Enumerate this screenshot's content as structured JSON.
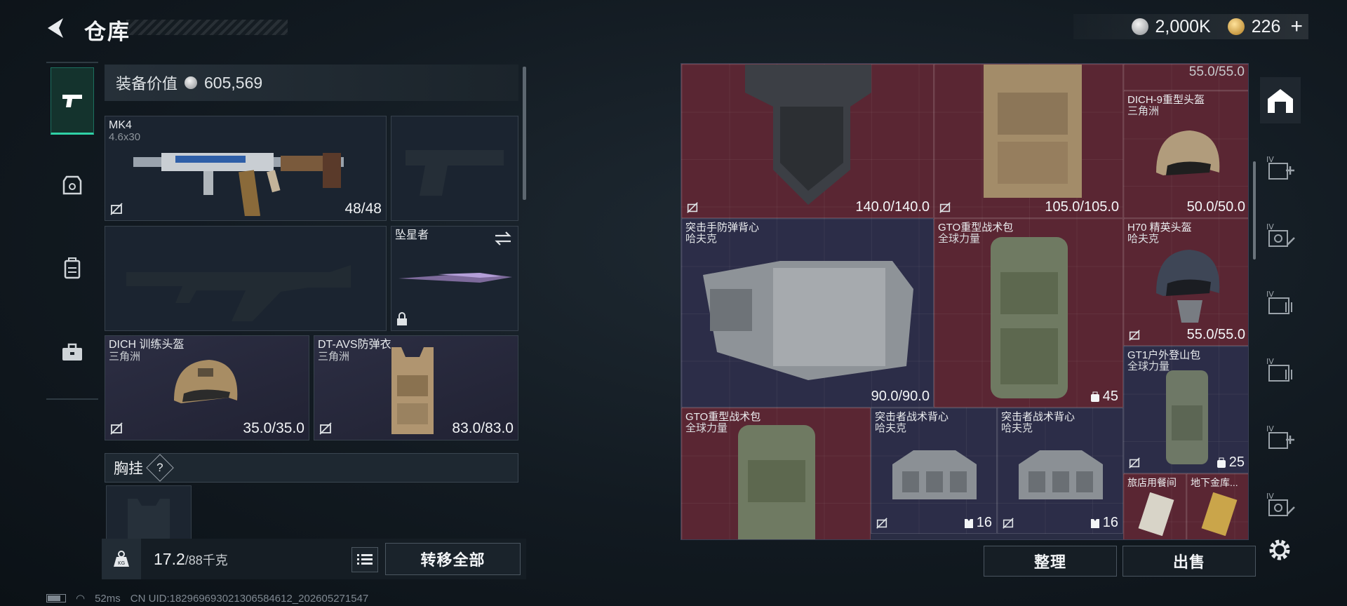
{
  "header": {
    "title": "仓库"
  },
  "currency": {
    "silver": "2,000K",
    "gold": "226",
    "plus": "+"
  },
  "equipment": {
    "value_label": "装备价值",
    "value": "605,569",
    "primary_weapon": {
      "name": "MK4",
      "caliber": "4.6x30",
      "durability": "48/48"
    },
    "melee": {
      "name": "坠星者"
    },
    "helmet": {
      "name": "DICH 训练头盔",
      "maker": "三角洲",
      "durability": "35.0/35.0"
    },
    "armor": {
      "name": "DT-AVS防弹衣",
      "maker": "三角洲",
      "durability": "83.0/83.0"
    },
    "chest_rig_label": "胸挂",
    "help": "?"
  },
  "footer": {
    "weight_current": "17.2",
    "weight_max": "/88千克",
    "transfer_all": "转移全部"
  },
  "grid_items": [
    {
      "name": "",
      "maker": "",
      "durability": "140.0/140.0",
      "color": "#5a2633"
    },
    {
      "name": "",
      "maker": "",
      "durability": "105.0/105.0",
      "color": "#5a2633"
    },
    {
      "name": "",
      "maker": "",
      "durability": "55.0/55.0",
      "color": "#5a2633"
    },
    {
      "name": "DICH-9重型头盔",
      "maker": "三角洲",
      "durability": "50.0/50.0",
      "color": "#5a2633"
    },
    {
      "name": "突击手防弹背心",
      "maker": "哈夫克",
      "durability": "90.0/90.0",
      "color": "#2c2d48"
    },
    {
      "name": "GTO重型战术包",
      "maker": "全球力量",
      "capacity": "45",
      "color": "#5a2633"
    },
    {
      "name": "H70 精英头盔",
      "maker": "哈夫克",
      "durability": "55.0/55.0",
      "color": "#5a2633"
    },
    {
      "name": "GT1户外登山包",
      "maker": "全球力量",
      "capacity": "25",
      "color": "#2c2d48"
    },
    {
      "name": "GTO重型战术包",
      "maker": "全球力量",
      "color": "#5a2633"
    },
    {
      "name": "突击者战术背心",
      "maker": "哈夫克",
      "capacity": "16",
      "color": "#2c2d48"
    },
    {
      "name": "突击者战术背心",
      "maker": "哈夫克",
      "capacity": "16",
      "color": "#2c2d48"
    },
    {
      "name": "旅店用餐间",
      "color": "#5a2633"
    },
    {
      "name": "地下金库...",
      "color": "#5a2633"
    }
  ],
  "actions": {
    "sort": "整理",
    "sell": "出售"
  },
  "status": {
    "ping": "52ms",
    "uid": "CN UID:1829696930213065846​12_202605271547"
  }
}
